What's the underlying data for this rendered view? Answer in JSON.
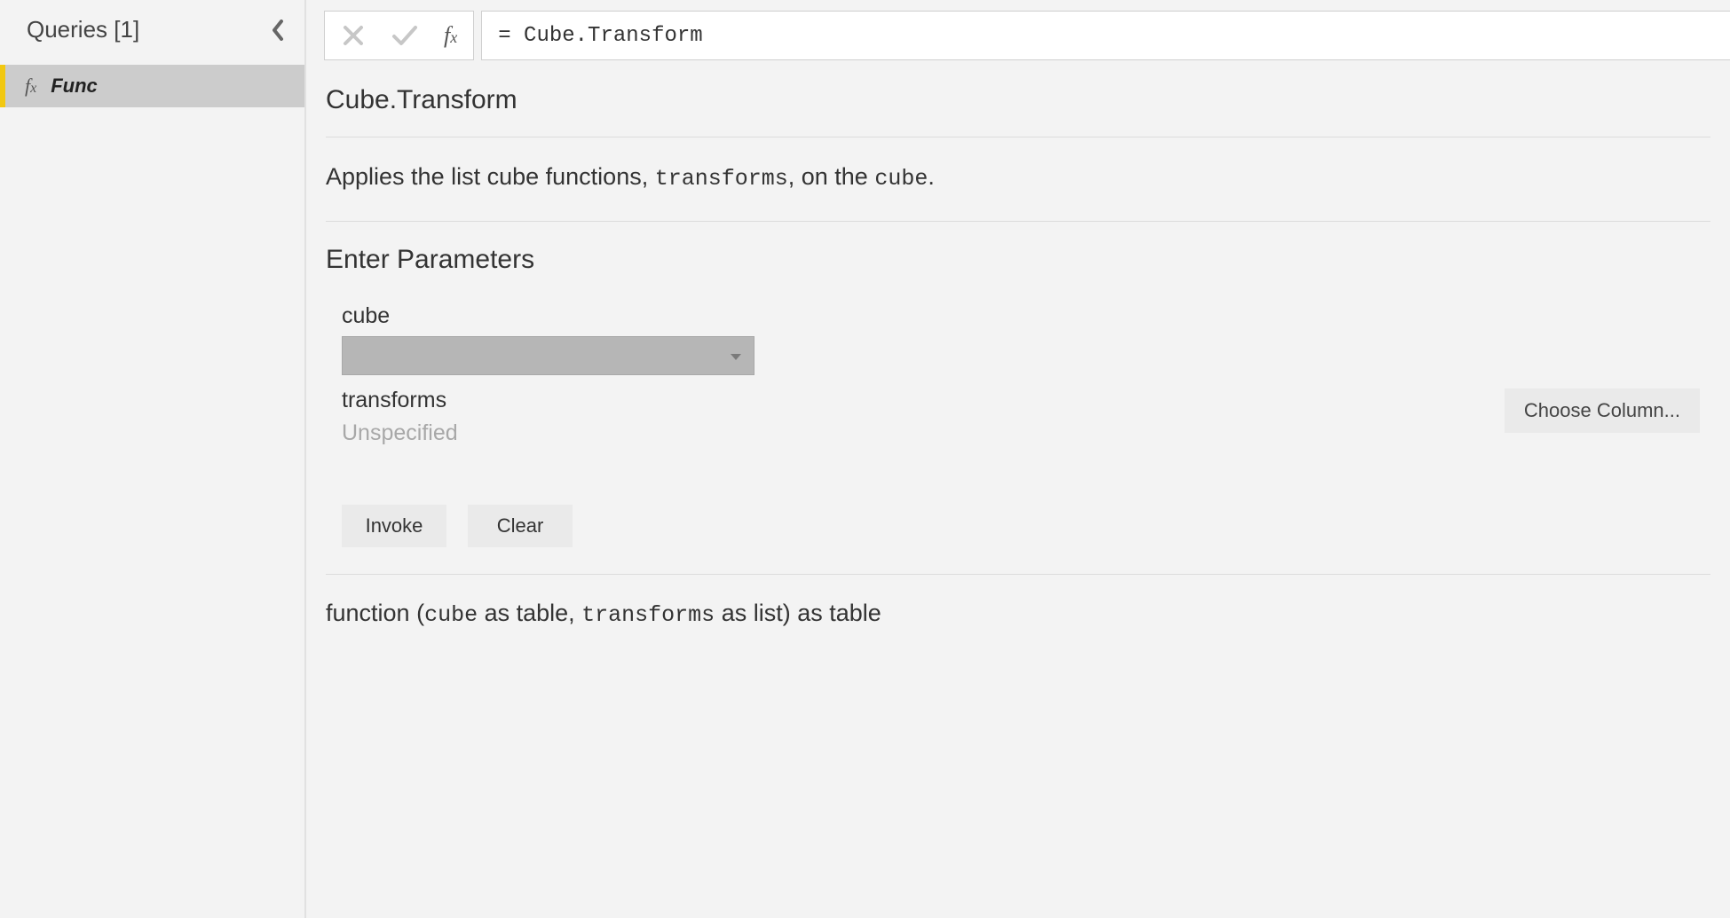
{
  "sidebar": {
    "title": "Queries [1]",
    "items": [
      {
        "icon": "fx",
        "name": "Func"
      }
    ]
  },
  "formulaBar": {
    "value": "= Cube.Transform"
  },
  "func": {
    "name": "Cube.Transform",
    "description": {
      "pre": "Applies the list cube functions, ",
      "p1": "transforms",
      "mid": ", on the ",
      "p2": "cube",
      "post": "."
    },
    "paramsHeading": "Enter Parameters",
    "params": {
      "cube": {
        "label": "cube"
      },
      "transforms": {
        "label": "transforms",
        "value": "Unspecified"
      }
    },
    "chooseColumn": "Choose Column...",
    "invoke": "Invoke",
    "clear": "Clear",
    "signature": {
      "s1": "function (",
      "p1": "cube",
      "s2": " as table, ",
      "p2": "transforms",
      "s3": " as list) as table"
    }
  }
}
